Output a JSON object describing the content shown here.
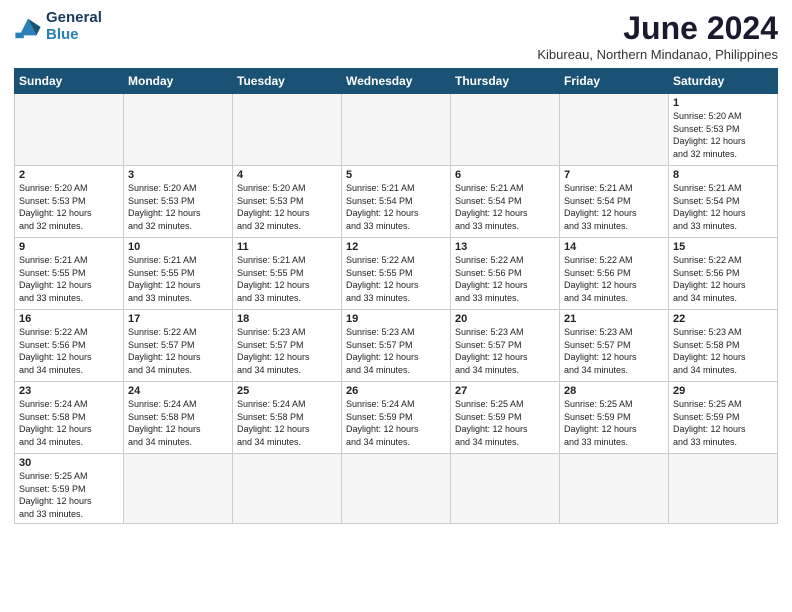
{
  "logo": {
    "line1": "General",
    "line2": "Blue"
  },
  "title": "June 2024",
  "subtitle": "Kibureau, Northern Mindanao, Philippines",
  "weekdays": [
    "Sunday",
    "Monday",
    "Tuesday",
    "Wednesday",
    "Thursday",
    "Friday",
    "Saturday"
  ],
  "weeks": [
    [
      {
        "day": "",
        "info": ""
      },
      {
        "day": "",
        "info": ""
      },
      {
        "day": "",
        "info": ""
      },
      {
        "day": "",
        "info": ""
      },
      {
        "day": "",
        "info": ""
      },
      {
        "day": "",
        "info": ""
      },
      {
        "day": "1",
        "info": "Sunrise: 5:20 AM\nSunset: 5:53 PM\nDaylight: 12 hours\nand 32 minutes."
      }
    ],
    [
      {
        "day": "2",
        "info": "Sunrise: 5:20 AM\nSunset: 5:53 PM\nDaylight: 12 hours\nand 32 minutes."
      },
      {
        "day": "3",
        "info": "Sunrise: 5:20 AM\nSunset: 5:53 PM\nDaylight: 12 hours\nand 32 minutes."
      },
      {
        "day": "4",
        "info": "Sunrise: 5:20 AM\nSunset: 5:53 PM\nDaylight: 12 hours\nand 32 minutes."
      },
      {
        "day": "5",
        "info": "Sunrise: 5:21 AM\nSunset: 5:54 PM\nDaylight: 12 hours\nand 33 minutes."
      },
      {
        "day": "6",
        "info": "Sunrise: 5:21 AM\nSunset: 5:54 PM\nDaylight: 12 hours\nand 33 minutes."
      },
      {
        "day": "7",
        "info": "Sunrise: 5:21 AM\nSunset: 5:54 PM\nDaylight: 12 hours\nand 33 minutes."
      },
      {
        "day": "8",
        "info": "Sunrise: 5:21 AM\nSunset: 5:54 PM\nDaylight: 12 hours\nand 33 minutes."
      }
    ],
    [
      {
        "day": "9",
        "info": "Sunrise: 5:21 AM\nSunset: 5:55 PM\nDaylight: 12 hours\nand 33 minutes."
      },
      {
        "day": "10",
        "info": "Sunrise: 5:21 AM\nSunset: 5:55 PM\nDaylight: 12 hours\nand 33 minutes."
      },
      {
        "day": "11",
        "info": "Sunrise: 5:21 AM\nSunset: 5:55 PM\nDaylight: 12 hours\nand 33 minutes."
      },
      {
        "day": "12",
        "info": "Sunrise: 5:22 AM\nSunset: 5:55 PM\nDaylight: 12 hours\nand 33 minutes."
      },
      {
        "day": "13",
        "info": "Sunrise: 5:22 AM\nSunset: 5:56 PM\nDaylight: 12 hours\nand 33 minutes."
      },
      {
        "day": "14",
        "info": "Sunrise: 5:22 AM\nSunset: 5:56 PM\nDaylight: 12 hours\nand 34 minutes."
      },
      {
        "day": "15",
        "info": "Sunrise: 5:22 AM\nSunset: 5:56 PM\nDaylight: 12 hours\nand 34 minutes."
      }
    ],
    [
      {
        "day": "16",
        "info": "Sunrise: 5:22 AM\nSunset: 5:56 PM\nDaylight: 12 hours\nand 34 minutes."
      },
      {
        "day": "17",
        "info": "Sunrise: 5:22 AM\nSunset: 5:57 PM\nDaylight: 12 hours\nand 34 minutes."
      },
      {
        "day": "18",
        "info": "Sunrise: 5:23 AM\nSunset: 5:57 PM\nDaylight: 12 hours\nand 34 minutes."
      },
      {
        "day": "19",
        "info": "Sunrise: 5:23 AM\nSunset: 5:57 PM\nDaylight: 12 hours\nand 34 minutes."
      },
      {
        "day": "20",
        "info": "Sunrise: 5:23 AM\nSunset: 5:57 PM\nDaylight: 12 hours\nand 34 minutes."
      },
      {
        "day": "21",
        "info": "Sunrise: 5:23 AM\nSunset: 5:57 PM\nDaylight: 12 hours\nand 34 minutes."
      },
      {
        "day": "22",
        "info": "Sunrise: 5:23 AM\nSunset: 5:58 PM\nDaylight: 12 hours\nand 34 minutes."
      }
    ],
    [
      {
        "day": "23",
        "info": "Sunrise: 5:24 AM\nSunset: 5:58 PM\nDaylight: 12 hours\nand 34 minutes."
      },
      {
        "day": "24",
        "info": "Sunrise: 5:24 AM\nSunset: 5:58 PM\nDaylight: 12 hours\nand 34 minutes."
      },
      {
        "day": "25",
        "info": "Sunrise: 5:24 AM\nSunset: 5:58 PM\nDaylight: 12 hours\nand 34 minutes."
      },
      {
        "day": "26",
        "info": "Sunrise: 5:24 AM\nSunset: 5:59 PM\nDaylight: 12 hours\nand 34 minutes."
      },
      {
        "day": "27",
        "info": "Sunrise: 5:25 AM\nSunset: 5:59 PM\nDaylight: 12 hours\nand 34 minutes."
      },
      {
        "day": "28",
        "info": "Sunrise: 5:25 AM\nSunset: 5:59 PM\nDaylight: 12 hours\nand 33 minutes."
      },
      {
        "day": "29",
        "info": "Sunrise: 5:25 AM\nSunset: 5:59 PM\nDaylight: 12 hours\nand 33 minutes."
      }
    ],
    [
      {
        "day": "30",
        "info": "Sunrise: 5:25 AM\nSunset: 5:59 PM\nDaylight: 12 hours\nand 33 minutes."
      },
      {
        "day": "",
        "info": ""
      },
      {
        "day": "",
        "info": ""
      },
      {
        "day": "",
        "info": ""
      },
      {
        "day": "",
        "info": ""
      },
      {
        "day": "",
        "info": ""
      },
      {
        "day": "",
        "info": ""
      }
    ]
  ]
}
